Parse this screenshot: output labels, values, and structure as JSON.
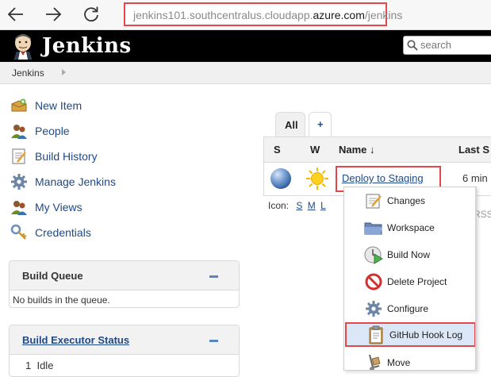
{
  "browser": {
    "url_prefix": "jenkins101.southcentralus.cloudapp.",
    "url_domain": "azure.com",
    "url_suffix": "/jenkins"
  },
  "header": {
    "title": "Jenkins",
    "search_placeholder": "search"
  },
  "breadcrumb": {
    "root": "Jenkins"
  },
  "sidebar": {
    "tasks": [
      {
        "label": "New Item",
        "icon": "new-item-icon"
      },
      {
        "label": "People",
        "icon": "people-icon"
      },
      {
        "label": "Build History",
        "icon": "build-history-icon"
      },
      {
        "label": "Manage Jenkins",
        "icon": "gear-icon"
      },
      {
        "label": "My Views",
        "icon": "people-icon"
      },
      {
        "label": "Credentials",
        "icon": "key-icon"
      }
    ]
  },
  "build_queue": {
    "title": "Build Queue",
    "empty_text": "No builds in the queue."
  },
  "executors": {
    "title": "Build Executor Status",
    "items": [
      {
        "index": "1",
        "status": "Idle"
      }
    ]
  },
  "views": {
    "tabs": [
      {
        "label": "All",
        "active": true
      },
      {
        "label": "+",
        "active": false
      }
    ]
  },
  "table": {
    "headers": {
      "status": "S",
      "weather": "W",
      "name": "Name ↓",
      "last_success": "Last S"
    },
    "rows": [
      {
        "name": "Deploy to Staging",
        "last_success": "6 min",
        "status_color": "blue",
        "weather": "sunny"
      }
    ],
    "icon_label": "Icon:",
    "icon_sizes": [
      "S",
      "M",
      "L"
    ],
    "rss_partial": "RSS"
  },
  "context_menu": {
    "items": [
      {
        "label": "Changes",
        "icon": "notepad-icon"
      },
      {
        "label": "Workspace",
        "icon": "folder-icon"
      },
      {
        "label": "Build Now",
        "icon": "clock-play-icon"
      },
      {
        "label": "Delete Project",
        "icon": "no-entry-icon"
      },
      {
        "label": "Configure",
        "icon": "gear-icon"
      },
      {
        "label": "GitHub Hook Log",
        "icon": "clipboard-icon",
        "highlighted": true
      },
      {
        "label": "Move",
        "icon": "hand-truck-icon"
      }
    ]
  },
  "colors": {
    "link": "#204a87",
    "highlight_border": "#e2474b",
    "header_bg": "#000000"
  }
}
